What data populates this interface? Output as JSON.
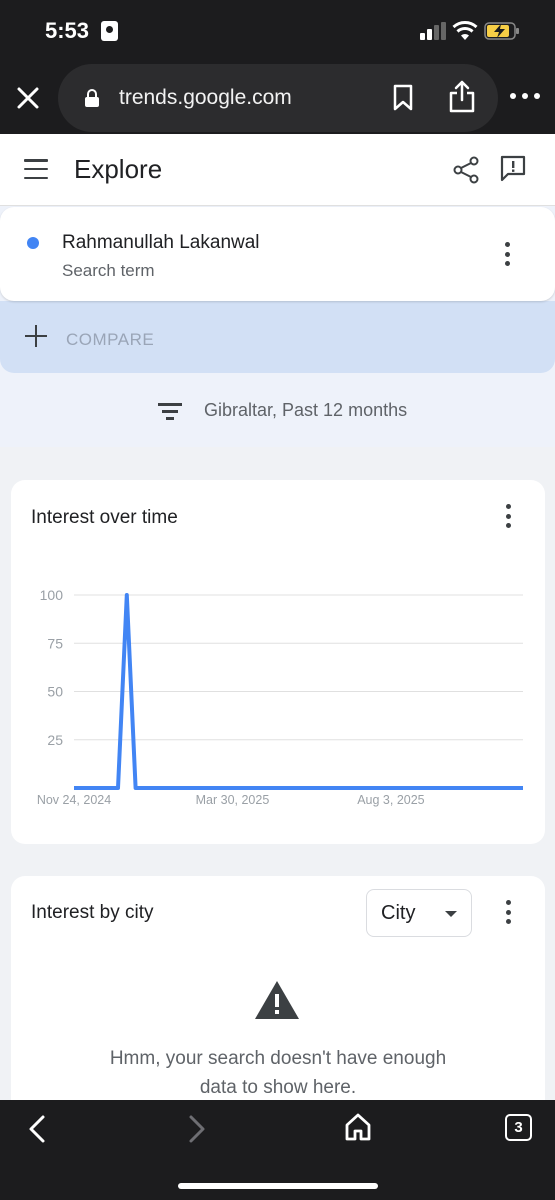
{
  "status_bar": {
    "time": "5:53"
  },
  "browser": {
    "url": "trends.google.com",
    "tab_count": "3"
  },
  "header": {
    "title": "Explore"
  },
  "search_term": {
    "term": "Rahmanullah Lakanwal",
    "subtitle": "Search term",
    "color": "#4285f4"
  },
  "compare": {
    "label": "COMPARE"
  },
  "filter": {
    "text": "Gibraltar, Past 12 months"
  },
  "interest_over_time": {
    "title": "Interest over time"
  },
  "interest_by_city": {
    "title": "Interest by city",
    "dropdown_value": "City",
    "no_data_line1": "Hmm, your search doesn't have enough",
    "no_data_line2": "data to show here."
  },
  "chart_data": {
    "type": "line",
    "title": "Interest over time",
    "xlabel": "",
    "ylabel": "",
    "ylim": [
      0,
      100
    ],
    "y_ticks": [
      "100",
      "75",
      "50",
      "25"
    ],
    "x_tick_labels": [
      "Nov 24, 2024",
      "Mar 30, 2025",
      "Aug 3, 2025"
    ],
    "series": [
      {
        "color": "#4285f4",
        "x": [
          "Nov 24, 2024",
          "Dec 1, 2024",
          "Dec 8, 2024",
          "Dec 15, 2024",
          "Dec 22, 2024",
          "Dec 29, 2024",
          "Jan 5, 2025",
          "Jan 12, 2025",
          "Jan 19, 2025",
          "Jan 26, 2025",
          "Feb 2, 2025",
          "Feb 9, 2025",
          "Feb 16, 2025",
          "Feb 23, 2025",
          "Mar 2, 2025",
          "Mar 9, 2025",
          "Mar 16, 2025",
          "Mar 23, 2025",
          "Mar 30, 2025",
          "Apr 6, 2025",
          "Apr 13, 2025",
          "Apr 20, 2025",
          "Apr 27, 2025",
          "May 4, 2025",
          "May 11, 2025",
          "May 18, 2025",
          "May 25, 2025",
          "Jun 1, 2025",
          "Jun 8, 2025",
          "Jun 15, 2025",
          "Jun 22, 2025",
          "Jun 29, 2025",
          "Jul 6, 2025",
          "Jul 13, 2025",
          "Jul 20, 2025",
          "Jul 27, 2025",
          "Aug 3, 2025",
          "Aug 10, 2025",
          "Aug 17, 2025",
          "Aug 24, 2025",
          "Aug 31, 2025",
          "Sep 7, 2025",
          "Sep 14, 2025",
          "Sep 21, 2025",
          "Sep 28, 2025",
          "Oct 5, 2025",
          "Oct 12, 2025",
          "Oct 19, 2025",
          "Oct 26, 2025",
          "Nov 2, 2025",
          "Nov 9, 2025",
          "Nov 16, 2025"
        ],
        "values": [
          0,
          0,
          0,
          0,
          0,
          0,
          100,
          0,
          0,
          0,
          0,
          0,
          0,
          0,
          0,
          0,
          0,
          0,
          0,
          0,
          0,
          0,
          0,
          0,
          0,
          0,
          0,
          0,
          0,
          0,
          0,
          0,
          0,
          0,
          0,
          0,
          0,
          0,
          0,
          0,
          0,
          0,
          0,
          0,
          0,
          0,
          0,
          0,
          0,
          0,
          0,
          0
        ]
      }
    ]
  }
}
